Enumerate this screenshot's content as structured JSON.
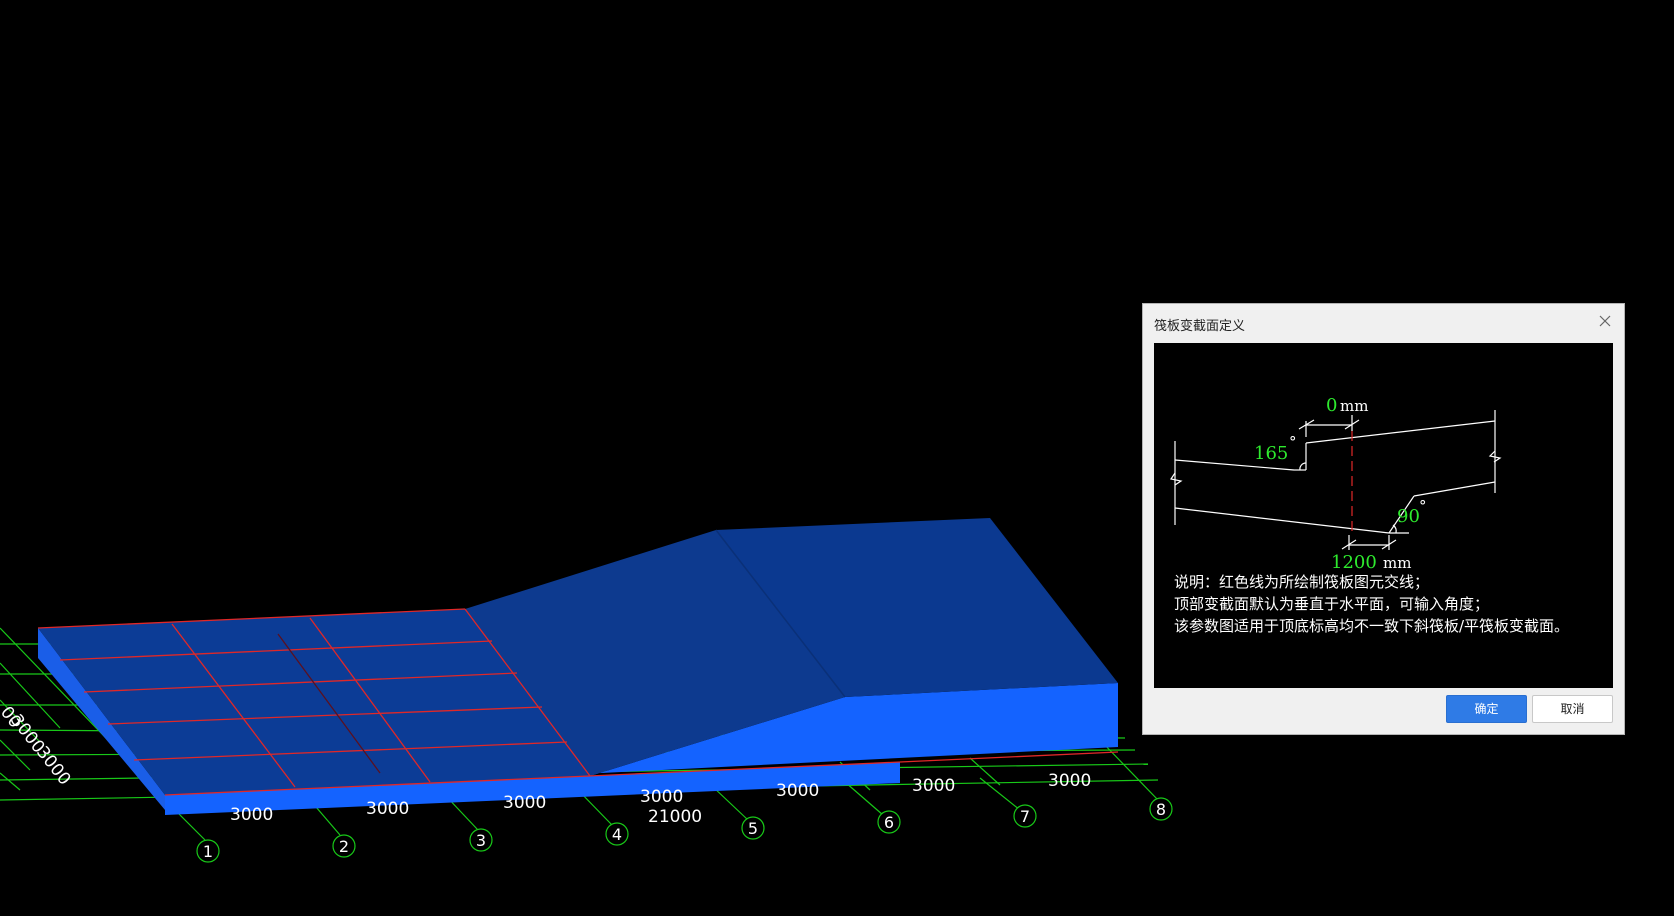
{
  "viewport": {
    "dimension_labels": [
      "3000",
      "3000",
      "3000",
      "3000",
      "3000",
      "3000",
      "3000"
    ],
    "total_label": "21000",
    "side_labels": [
      "00",
      "3000",
      "3000"
    ],
    "axis_numbers": [
      "1",
      "2",
      "3",
      "4",
      "5",
      "6",
      "7",
      "8"
    ],
    "colors": {
      "slab_top": "#0c3c96",
      "slab_side": "#1463ff",
      "grid": "#18c818",
      "red_lines": "#e02828"
    }
  },
  "dialog": {
    "title": "筏板变截面定义",
    "diagram": {
      "top_offset_value": "0",
      "top_offset_unit": "mm",
      "top_angle": "165",
      "bottom_angle": "90",
      "bottom_length_value": "1200",
      "bottom_length_unit": "mm",
      "degree_symbol": "°"
    },
    "notes": [
      "说明：红色线为所绘制筏板图元交线；",
      "顶部变截面默认为垂直于水平面，可输入角度；",
      "该参数图适用于顶底标高均不一致下斜筏板/平筏板变截面。"
    ],
    "ok_label": "确定",
    "cancel_label": "取消"
  }
}
